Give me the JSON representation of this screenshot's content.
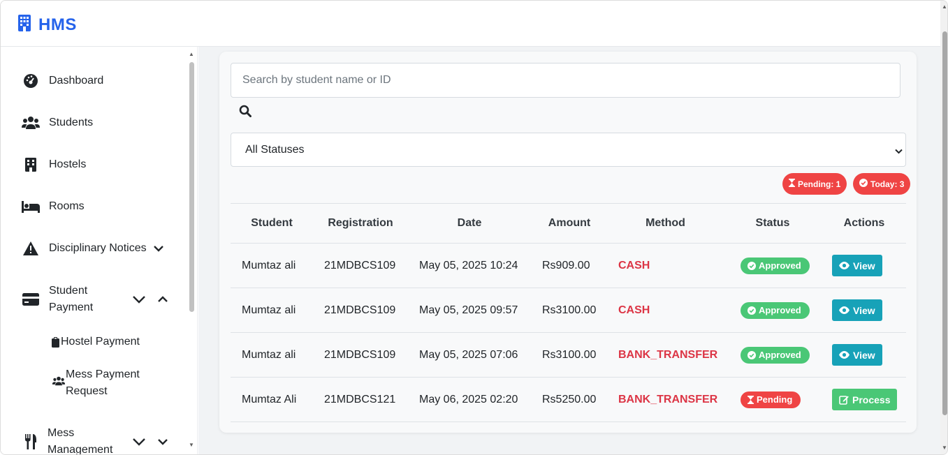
{
  "app": {
    "title": "HMS"
  },
  "sidebar": {
    "items": [
      {
        "label": "Dashboard",
        "icon": "dashboard-icon"
      },
      {
        "label": "Students",
        "icon": "users-icon"
      },
      {
        "label": "Hostels",
        "icon": "building-icon"
      },
      {
        "label": "Rooms",
        "icon": "bed-icon"
      },
      {
        "label": "Disciplinary Notices",
        "icon": "warning-icon"
      },
      {
        "label": "Student Payment",
        "line1": "Student",
        "line2": "Payment",
        "icon": "credit-card-icon"
      },
      {
        "label": "Mess Management",
        "line1": "Mess",
        "line2": "Management",
        "icon": "utensils-icon"
      }
    ],
    "sub_items": [
      {
        "label": "Hostel Payment",
        "icon": "clipboard-icon"
      },
      {
        "label": "Mess Payment Request",
        "line1": "Mess Payment",
        "line2": "Request",
        "icon": "users-icon"
      }
    ]
  },
  "search": {
    "placeholder": "Search by student name or ID",
    "icon": "search-icon"
  },
  "filter": {
    "selected": "All Statuses"
  },
  "badges": {
    "pending": "Pending: 1",
    "today": "Today: 3"
  },
  "table": {
    "headers": [
      "Student",
      "Registration",
      "Date",
      "Amount",
      "Method",
      "Status",
      "Actions"
    ],
    "rows": [
      {
        "student": "Mumtaz ali",
        "registration": "21MDBCS109",
        "date": "May 05, 2025 10:24",
        "amount": "Rs909.00",
        "method": "CASH",
        "status": "Approved",
        "action": "View"
      },
      {
        "student": "Mumtaz ali",
        "registration": "21MDBCS109",
        "date": "May 05, 2025 09:57",
        "amount": "Rs3100.00",
        "method": "CASH",
        "status": "Approved",
        "action": "View"
      },
      {
        "student": "Mumtaz ali",
        "registration": "21MDBCS109",
        "date": "May 05, 2025 07:06",
        "amount": "Rs3100.00",
        "method": "BANK_TRANSFER",
        "status": "Approved",
        "action": "View"
      },
      {
        "student": "Mumtaz Ali",
        "registration": "21MDBCS121",
        "date": "May 06, 2025 02:20",
        "amount": "Rs5250.00",
        "method": "BANK_TRANSFER",
        "status": "Pending",
        "action": "Process"
      }
    ]
  },
  "colors": {
    "brand": "#2563eb",
    "approved": "#4ac776",
    "pending": "#ef4444",
    "view": "#17a2b8",
    "method": "#dc3545"
  }
}
